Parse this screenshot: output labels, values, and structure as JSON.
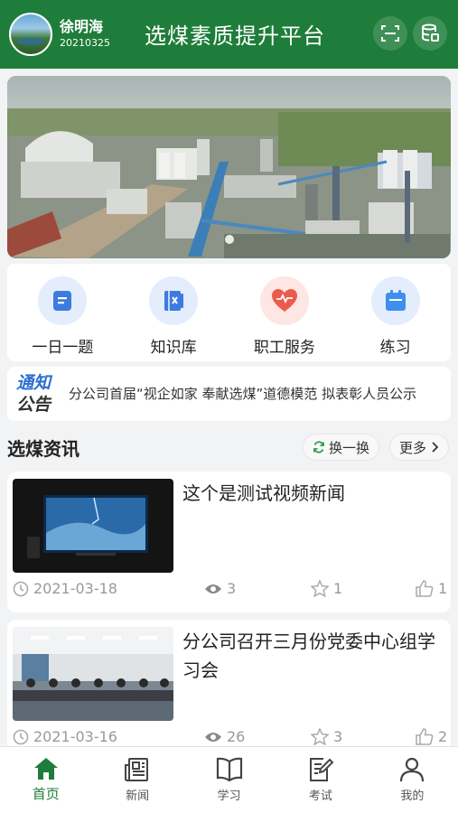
{
  "user": {
    "name": "徐明海",
    "id": "20210325"
  },
  "app_title": "选煤素质提升平台",
  "header_icons": [
    "scan-icon",
    "database-icon"
  ],
  "banner": {
    "page_count": 1,
    "active_page": 1
  },
  "quick_nav": [
    {
      "label": "一日一题",
      "icon": "daily-question-icon",
      "color": "#3d7be0"
    },
    {
      "label": "知识库",
      "icon": "knowledge-base-icon",
      "color": "#3d7be0"
    },
    {
      "label": "职工服务",
      "icon": "heart-icon",
      "color": "#ec5a4d"
    },
    {
      "label": "练习",
      "icon": "calendar-icon",
      "color": "#3d8ff0"
    }
  ],
  "notice": {
    "tag_line1": "通知",
    "tag_line2": "公告",
    "text": "分公司首届“视企如家 奉献选煤”道德模范 拟表彰人员公示"
  },
  "news_section": {
    "title": "选煤资讯",
    "switch_label": "换一换",
    "more_label": "更多",
    "items": [
      {
        "title": "这个是测试视频新闻",
        "date": "2021-03-18",
        "views": "3",
        "stars": "1",
        "likes": "1"
      },
      {
        "title": "分公司召开三月份党委中心组学习会",
        "date": "2021-03-16",
        "views": "26",
        "stars": "3",
        "likes": "2"
      }
    ]
  },
  "tabs": [
    {
      "label": "首页",
      "icon": "home-icon",
      "active": true
    },
    {
      "label": "新闻",
      "icon": "newspaper-icon",
      "active": false
    },
    {
      "label": "学习",
      "icon": "book-icon",
      "active": false
    },
    {
      "label": "考试",
      "icon": "exam-edit-icon",
      "active": false
    },
    {
      "label": "我的",
      "icon": "user-icon",
      "active": false
    }
  ],
  "colors": {
    "primary": "#1e7d3a",
    "accent_blue": "#2b6fd0"
  }
}
